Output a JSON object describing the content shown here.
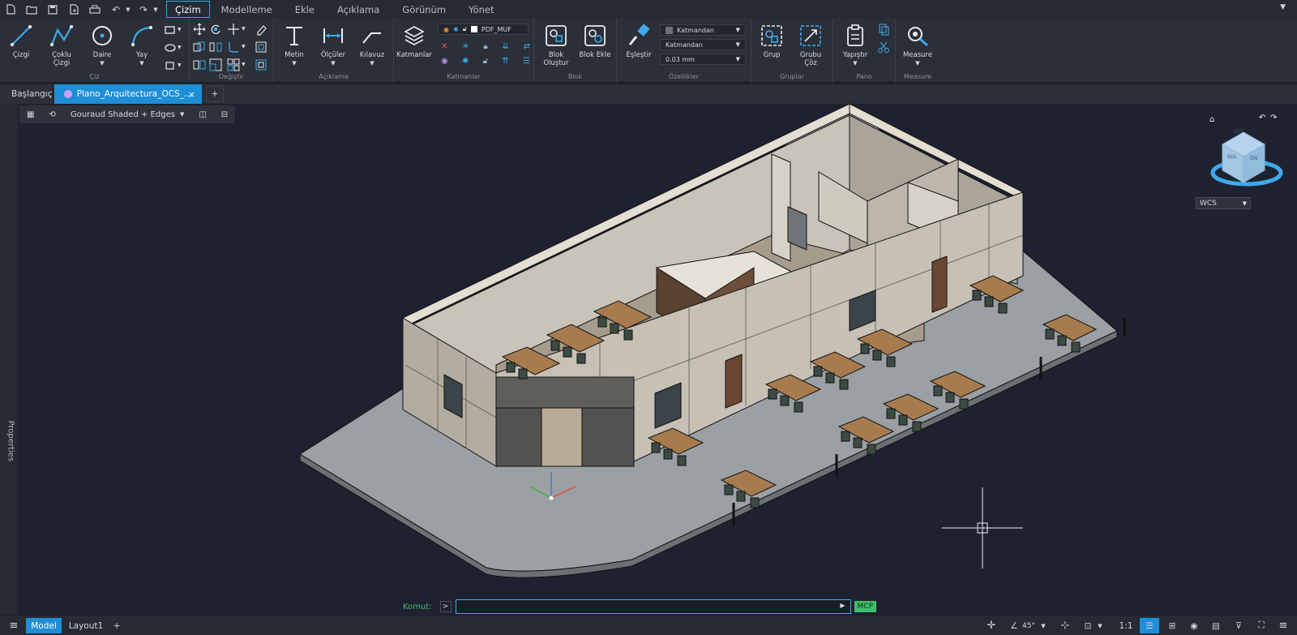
{
  "quick_access": [
    "new-icon",
    "open-icon",
    "save-icon",
    "save-as-icon",
    "print-icon",
    "undo-icon",
    "redo-icon"
  ],
  "menu": {
    "tabs": [
      "Çizim",
      "Modelleme",
      "Ekle",
      "Açıklama",
      "Görünüm",
      "Yönet"
    ],
    "active": "Çizim"
  },
  "ribbon": {
    "draw": {
      "label": "Çiz",
      "line": "Çizgi",
      "polyline_1": "Çoklu",
      "polyline_2": "Çizgi",
      "circle": "Daire",
      "arc": "Yay"
    },
    "modify": {
      "label": "Değiştir"
    },
    "annotation": {
      "label": "Açıklama",
      "text": "Metin",
      "dimensions": "Ölçüler",
      "leader": "Kılavuz"
    },
    "layers": {
      "label": "Katmanlar",
      "layers_btn": "Katmanlar",
      "current_layer": "PDF_MUF"
    },
    "block": {
      "label": "Blok",
      "create_1": "Blok",
      "create_2": "Oluştur",
      "insert": "Blok Ekle"
    },
    "properties": {
      "label": "Özellikler",
      "match": "Eşleştir",
      "color": "Katmandan",
      "linetype": "Katmandan",
      "lineweight": "0.03 mm"
    },
    "groups": {
      "label": "Gruplar",
      "group": "Grup",
      "ungroup_1": "Grubu",
      "ungroup_2": "Çöz"
    },
    "clipboard": {
      "label": "Pano",
      "paste": "Yapıştır"
    },
    "measure": {
      "label": "Measure",
      "measure_btn": "Measure"
    }
  },
  "document_tabs": {
    "home": "Başlangıç",
    "active_file": "Plano_Arquitectura_OCS_...",
    "add": "+"
  },
  "viewport": {
    "visual_style": "Gouraud Shaded + Edges",
    "ucs": "WCS",
    "viewcube": {
      "top": "ÜST",
      "left": "SOL",
      "front": "ÖN"
    },
    "axis": {
      "x": "X",
      "y": "Y",
      "z": "Z"
    }
  },
  "side_panel": {
    "label": "Properties"
  },
  "command": {
    "label": "Komut:",
    "prompt": ">",
    "value": "",
    "mcp": "MCP"
  },
  "status": {
    "tabs": [
      "Model",
      "Layout1"
    ],
    "active": "Model",
    "add": "+",
    "angle": "45°",
    "scale": "1:1"
  },
  "colors": {
    "accent": "#1e8ed6",
    "bg": "#1e2230",
    "ribbon": "#2b2f37",
    "mcp": "#3fbf6b"
  }
}
